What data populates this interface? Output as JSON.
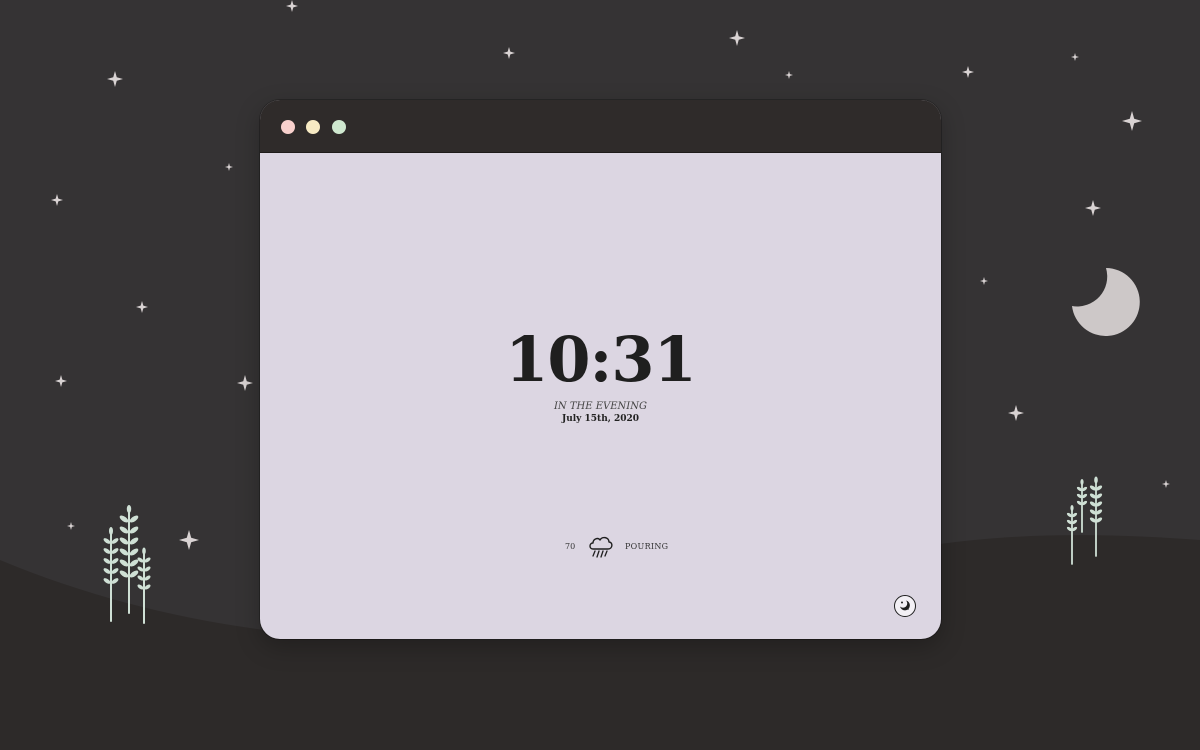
{
  "window": {
    "traffic_lights": [
      {
        "name": "close",
        "color": "#f8d0cc"
      },
      {
        "name": "minimize",
        "color": "#f7eac3"
      },
      {
        "name": "maximize",
        "color": "#cfe8cf"
      }
    ]
  },
  "clock": {
    "time": "10:31",
    "period": "IN THE EVENING",
    "date": "July 15th, 2020"
  },
  "weather": {
    "temperature": "70",
    "icon": "rain-cloud-icon",
    "condition": "POURING"
  },
  "controls": {
    "mode_toggle_icon": "night-mode-icon"
  },
  "colors": {
    "background": "#353334",
    "hill": "#2d2a29",
    "window_content": "#dcd6e2",
    "titlebar": "#2f2b2a",
    "star": "#d9d3d3",
    "moon": "#cdc8c8",
    "wheat": "#cfe0d5",
    "text": "#1f1f1f"
  }
}
